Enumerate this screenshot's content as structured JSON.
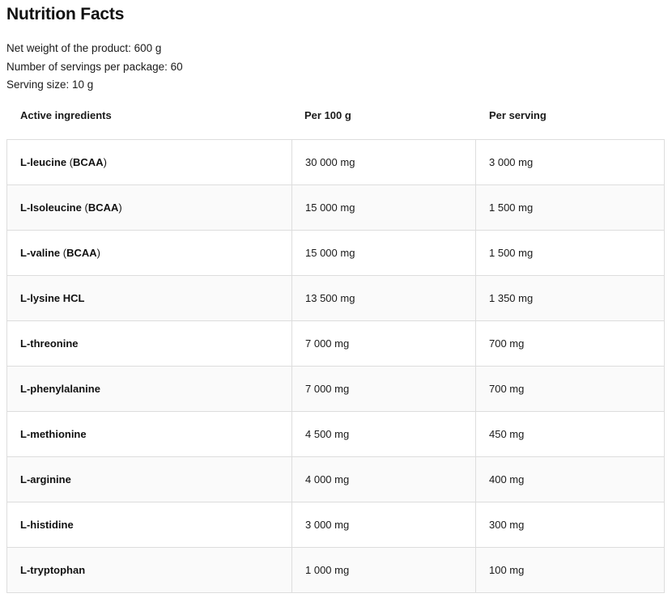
{
  "title": "Nutrition Facts",
  "meta": {
    "net_weight": "Net weight of the product: 600 g",
    "servings_per_package": "Number of servings per package: 60",
    "serving_size": "Serving size: 10 g"
  },
  "table": {
    "headers": [
      "Active ingredients",
      "Per 100 g",
      "Per serving"
    ],
    "rows": [
      {
        "name": "L-leucine",
        "tag": "BCAA",
        "per_100g": "30 000 mg",
        "per_serving": "3 000 mg"
      },
      {
        "name": "L-Isoleucine",
        "tag": "BCAA",
        "per_100g": "15 000 mg",
        "per_serving": "1 500 mg"
      },
      {
        "name": "L-valine",
        "tag": "BCAA",
        "per_100g": "15 000 mg",
        "per_serving": "1 500 mg"
      },
      {
        "name": "L-lysine HCL",
        "tag": "",
        "per_100g": "13 500 mg",
        "per_serving": "1 350 mg"
      },
      {
        "name": "L-threonine",
        "tag": "",
        "per_100g": "7 000 mg",
        "per_serving": "700 mg"
      },
      {
        "name": "L-phenylalanine",
        "tag": "",
        "per_100g": "7 000 mg",
        "per_serving": "700 mg"
      },
      {
        "name": "L-methionine",
        "tag": "",
        "per_100g": "4 500 mg",
        "per_serving": "450 mg"
      },
      {
        "name": "L-arginine",
        "tag": "",
        "per_100g": "4 000 mg",
        "per_serving": "400 mg"
      },
      {
        "name": "L-histidine",
        "tag": "",
        "per_100g": "3 000 mg",
        "per_serving": "300 mg"
      },
      {
        "name": "L-tryptophan",
        "tag": "",
        "per_100g": "1 000 mg",
        "per_serving": "100 mg"
      }
    ]
  }
}
